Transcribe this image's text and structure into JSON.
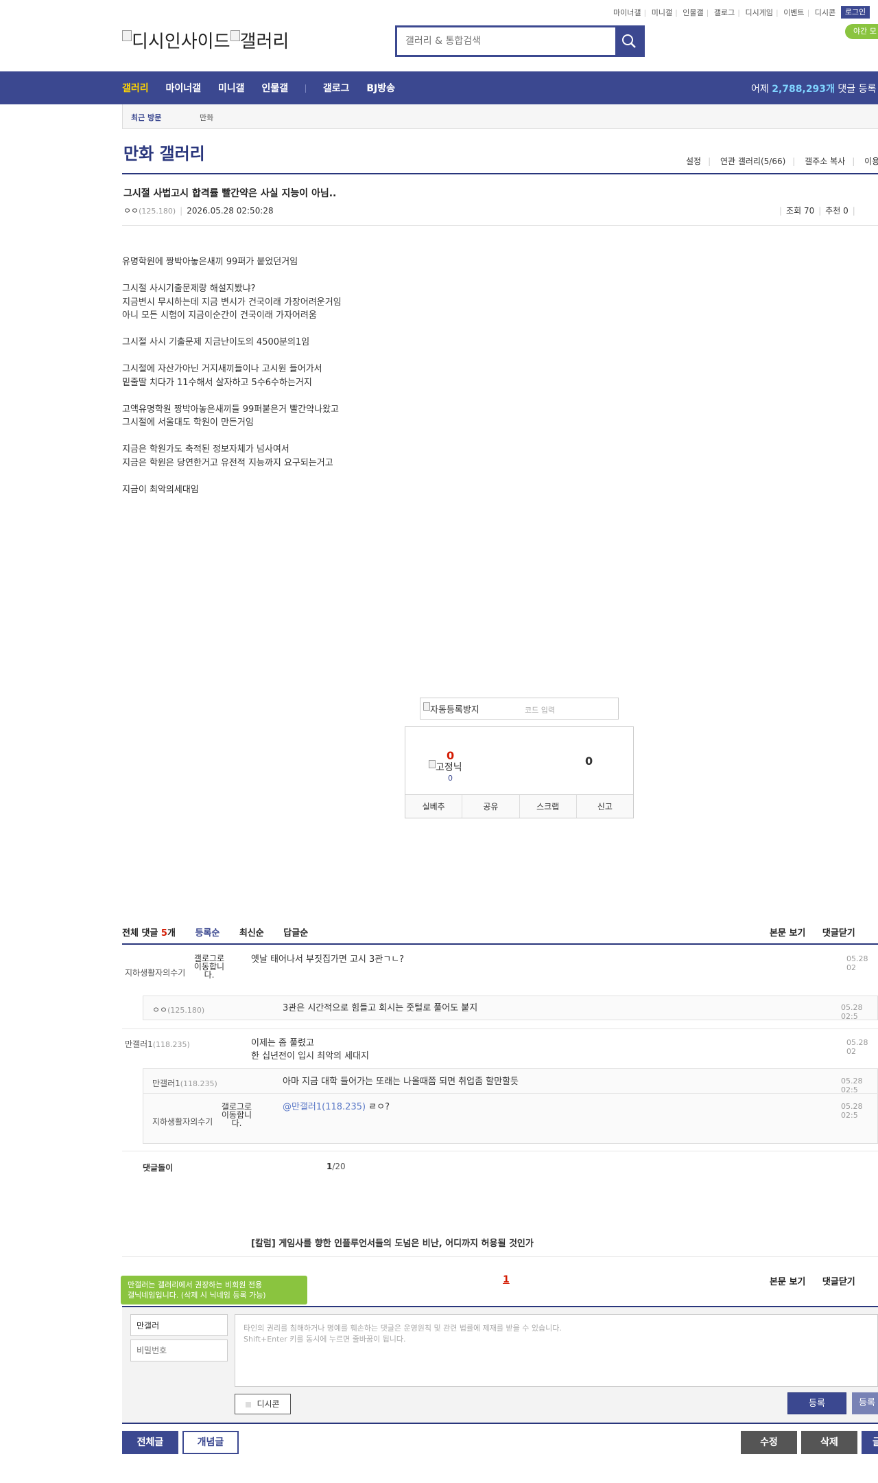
{
  "header": {
    "top_links": [
      "마이너갤",
      "미니갤",
      "인물갤",
      "갤로그",
      "디시게임",
      "이벤트",
      "디시콘"
    ],
    "login_label": "로그인",
    "night_label": "야간 모",
    "logo_alt_1": "디시인사이드",
    "logo_alt_2": "갤러리",
    "search_placeholder": "갤러리 & 통합검색"
  },
  "nav": {
    "items": [
      "갤러리",
      "마이너갤",
      "미니갤",
      "인물갤",
      "갤로그",
      "BJ방송"
    ],
    "stats_prefix": "어제 ",
    "stats_value": "2,788,293개",
    "stats_suffix": " 댓글 등록"
  },
  "recent": {
    "label": "최근 방문",
    "item": "만화"
  },
  "gallery": {
    "title": "만화 갤러리",
    "menu": [
      "설정",
      "연관 갤러리(5/66)",
      "갤주소 복사",
      "이용"
    ]
  },
  "post": {
    "title": "그시절 사법고시 합격률 빨간약은 사실 지능이 아님..",
    "author": "ㅇㅇ",
    "author_ip": "(125.180)",
    "date": "2026.05.28 02:50:28",
    "views": "조회 70",
    "recommend": "추천 0",
    "body": "유명학원에 짱박아놓은새끼 99퍼가 붙었던거임\n\n그시절 사시기출문제랑 해설지봤냐?\n지금변시 무시하는데 지금 변시가 건국이래 가장어려운거임\n아니 모든 시험이 지금이순간이 건국이래 가자어려움\n\n그시절 사시 기출문제 지금난이도의 4500분의1임\n\n그시절에 자산가아닌 거지새끼들이나 고시원 들어가서\n밑줄딸 치다가 11수해서 살자하고 5수6수하는거지\n\n고액유명학원 짱박아놓은새끼들 99퍼붙은거 빨간약나왔고\n그시절에 서울대도 학원이 만든거임\n\n지금은 학원가도 축적된 정보자체가 넘사여서\n지금은 학원은 당연한거고 유전적 지능까지 요구되는거고\n\n지금이 최악의세대임"
  },
  "captcha": {
    "image_alt": "자동등록방지",
    "placeholder": "코드 입력"
  },
  "recommend_box": {
    "up": "0",
    "fixed_nick_alt": "고정닉",
    "fixed_count": "0",
    "down": "0",
    "buttons": [
      "실베추",
      "공유",
      "스크랩",
      "신고"
    ]
  },
  "comments": {
    "header_prefix": "전체 댓글 ",
    "count": "5",
    "header_suffix": "개",
    "sorts": [
      "등록순",
      "최신순",
      "답글순"
    ],
    "right_links": [
      "본문 보기",
      "댓글닫기"
    ],
    "gallog_alt": "갤로그로 이동합니다.",
    "items": [
      {
        "nick": "지하생활자의수기",
        "text": "옛날 태어나서 부짓집가면 고시 3관ㄱㄴ?",
        "date": "05.28 02"
      },
      {
        "nick": "ㅇㅇ",
        "ip": "(125.180)",
        "text": "3관은 시간적으로 힘들고 회시는 줏털로 풀어도 붙지",
        "date": "05.28 02:5"
      },
      {
        "nick": "만갤러1",
        "ip": "(118.235)",
        "text": "이제는 좀 풀렸고\n한 십년전이 입시 최악의 세대지",
        "date": "05.28 02"
      },
      {
        "nick": "만갤러1",
        "ip": "(118.235)",
        "text": "아마 지금 대학 들어가는 또래는 나올때쯤 되면 취업좀 할만할듯",
        "date": "05.28 02:5"
      },
      {
        "nick": "지하생활자의수기",
        "mention": "@만갤러1(118.235)",
        "text": " ㄹㅇ?",
        "date": "05.28 02:5"
      }
    ],
    "bot_label": "댓글돌이",
    "page_current": "1",
    "page_total": "/20"
  },
  "column_link": "[칼럼] 게임사를 향한 인플루언서들의 도넘은 비난, 어디까지 허용될 것인가",
  "pager": {
    "current": "1"
  },
  "comment_form": {
    "tooltip": "만갤러는 갤러리에서 권장하는 비회원 전용\n갤닉네임입니다. (삭제 시 닉네임 등록 가능)",
    "nick_value": "만갤러",
    "pw_placeholder": "비밀번호",
    "textarea_placeholder": "타인의 권리를 침해하거나 명예를 훼손하는 댓글은 운영원칙 및 관련 법률에 제재를 받을 수 있습니다.\nShift+Enter 키를 동시에 누르면 줄바꿈이 됩니다.",
    "dccon_label": "디시콘",
    "submit_label": "등록",
    "submit2_label": "등록"
  },
  "bottom_buttons": {
    "all": "전체글",
    "concept": "개념글",
    "edit": "수정",
    "delete": "삭제",
    "write": "글"
  },
  "colors": {
    "brand": "#3b4890",
    "accent_yellow": "#ffd400",
    "green": "#8ac43f",
    "red": "#d31900"
  }
}
